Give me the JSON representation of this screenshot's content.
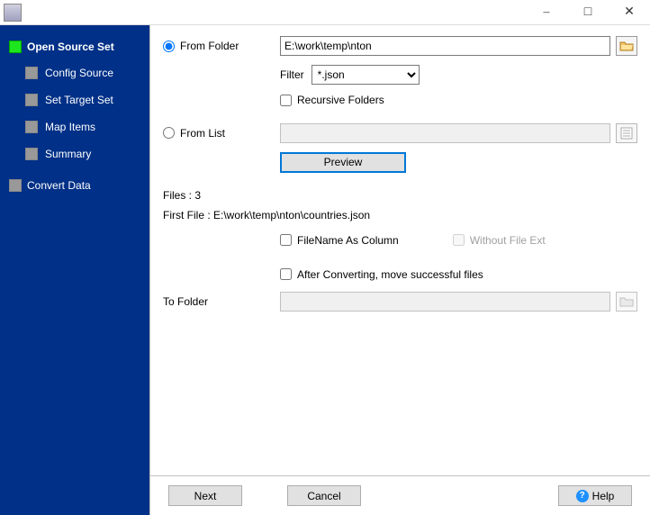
{
  "nav": {
    "items": [
      {
        "label": "Open Source Set"
      },
      {
        "label": "Config Source"
      },
      {
        "label": "Set Target Set"
      },
      {
        "label": "Map Items"
      },
      {
        "label": "Summary"
      },
      {
        "label": "Convert Data"
      }
    ]
  },
  "main": {
    "from_folder_label": "From Folder",
    "from_folder_value": "E:\\work\\temp\\nton",
    "filter_label": "Filter",
    "filter_value": "*.json",
    "recursive_label": "Recursive Folders",
    "from_list_label": "From List",
    "from_list_value": "",
    "preview_label": "Preview",
    "files_count_label": "Files : 3",
    "first_file_label": "First File : E:\\work\\temp\\nton\\countries.json",
    "filename_as_column_label": "FileName As Column",
    "without_ext_label": "Without File Ext",
    "after_converting_label": "After Converting, move successful files",
    "to_folder_label": "To Folder",
    "to_folder_value": ""
  },
  "footer": {
    "next": "Next",
    "cancel": "Cancel",
    "help": "Help"
  }
}
